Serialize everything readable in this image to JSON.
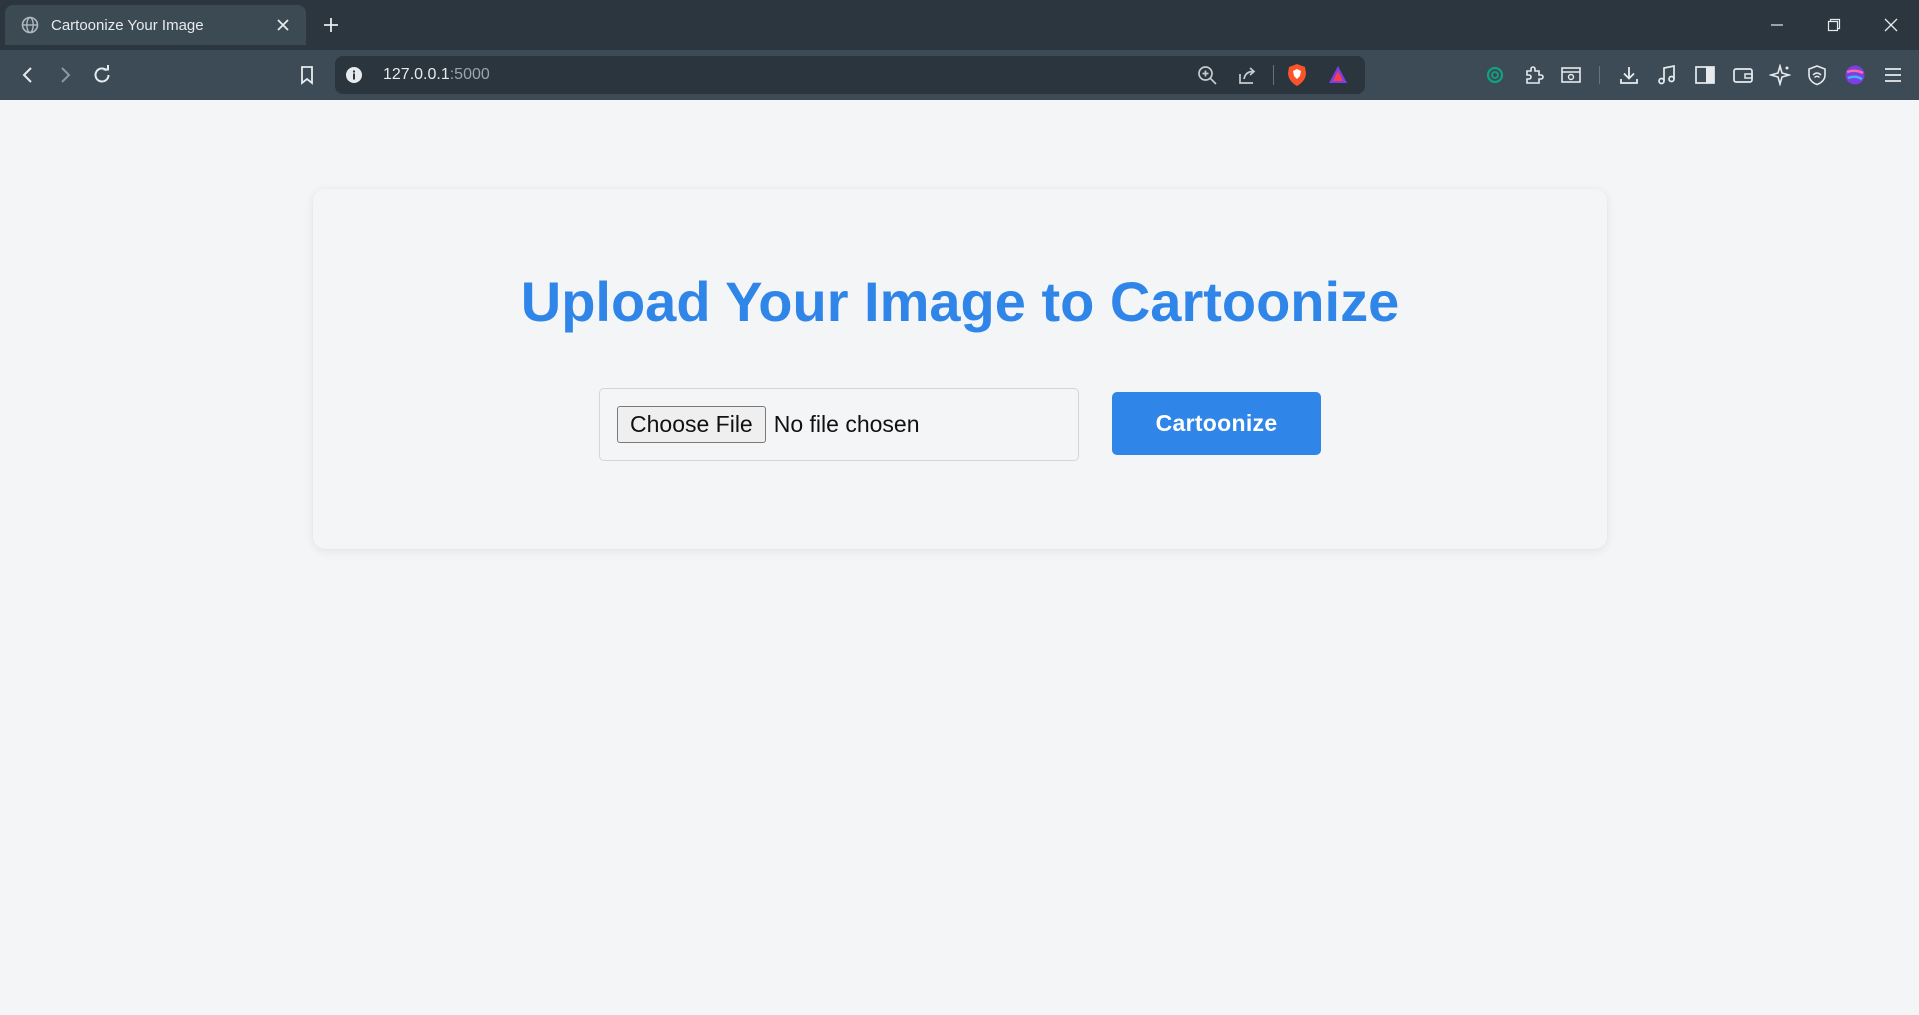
{
  "browser": {
    "tab": {
      "title": "Cartoonize Your Image",
      "favicon": "globe-icon"
    },
    "address_bar": {
      "host": "127.0.0.1",
      "port": ":5000"
    },
    "accent_colors": {
      "brave_shield": "#fb542b",
      "rewards": "#7b3fe4",
      "openai": "#10a37f"
    }
  },
  "page": {
    "heading": "Upload Your Image to Cartoonize",
    "file_input": {
      "button_label": "Choose File",
      "status": "No file chosen"
    },
    "submit_label": "Cartoonize",
    "accent_color": "#2f86e8"
  }
}
